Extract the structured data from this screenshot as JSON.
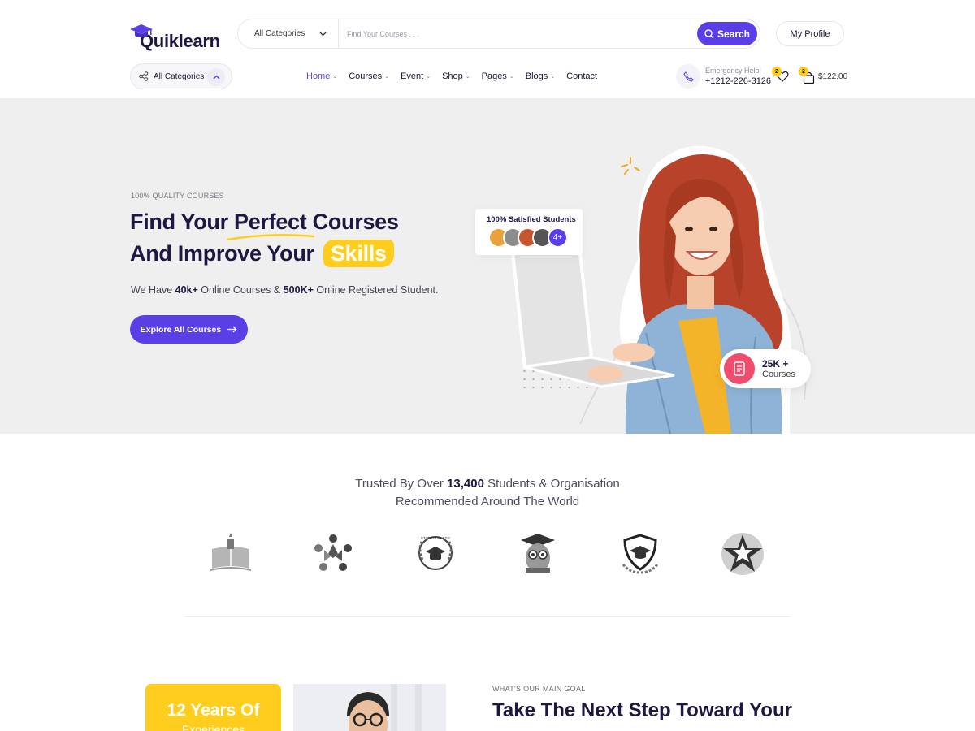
{
  "header": {
    "logo_text": "Quiklearn",
    "search": {
      "category": "All Categories",
      "placeholder": "Find Your Courses . . .",
      "button": "Search"
    },
    "profile_button": "My Profile",
    "all_categories": "All Categories",
    "nav": [
      {
        "label": "Home",
        "active": true,
        "dropdown": true
      },
      {
        "label": "Courses",
        "active": false,
        "dropdown": true
      },
      {
        "label": "Event",
        "active": false,
        "dropdown": true
      },
      {
        "label": "Shop",
        "active": false,
        "dropdown": true
      },
      {
        "label": "Pages",
        "active": false,
        "dropdown": true
      },
      {
        "label": "Blogs",
        "active": false,
        "dropdown": true
      },
      {
        "label": "Contact",
        "active": false,
        "dropdown": false
      }
    ],
    "emergency": {
      "label": "Emergency Help!",
      "number": "+1212-226-3126"
    },
    "wishlist_count": "2",
    "cart_count": "2",
    "cart_total": "$122.00"
  },
  "hero": {
    "tag": "100% QUALITY COURSES",
    "title_line1_pre": "Find Your ",
    "title_line1_highlight": "Perfect",
    "title_line1_post": " Courses",
    "title_line2_pre": "And Improve Your ",
    "title_line2_highlight": "Skills",
    "sub_pre": "We Have ",
    "sub_b1": "40k+",
    "sub_mid": " Online Courses & ",
    "sub_b2": "500K+",
    "sub_post": " Online Registered Student.",
    "button": "Explore All Courses",
    "satisfied_title": "100% Satisfied Students",
    "satisfied_more": "4+",
    "courses_num": "25K +",
    "courses_label": "Courses"
  },
  "trusted": {
    "line1_pre": "Trusted By Over ",
    "line1_num": "13,400",
    "line1_post": " Students & Organisation",
    "line2": "Recommended Around The World",
    "logos": [
      "book-emblem",
      "people-circle",
      "state-college",
      "owl-graduate",
      "shield-cap",
      "star-badge"
    ],
    "state_college_text": "STATE COLLEGE"
  },
  "goal": {
    "years_title": "12 Years Of",
    "years_sub": "Experiences",
    "tag": "WHAT'S OUR MAIN GOAL",
    "title": "Take The Next Step Toward Your"
  },
  "colors": {
    "accent": "#5b3fe6",
    "yellow": "#ffcd1e",
    "dark": "#1d1741",
    "pink": "#f04c6d"
  }
}
